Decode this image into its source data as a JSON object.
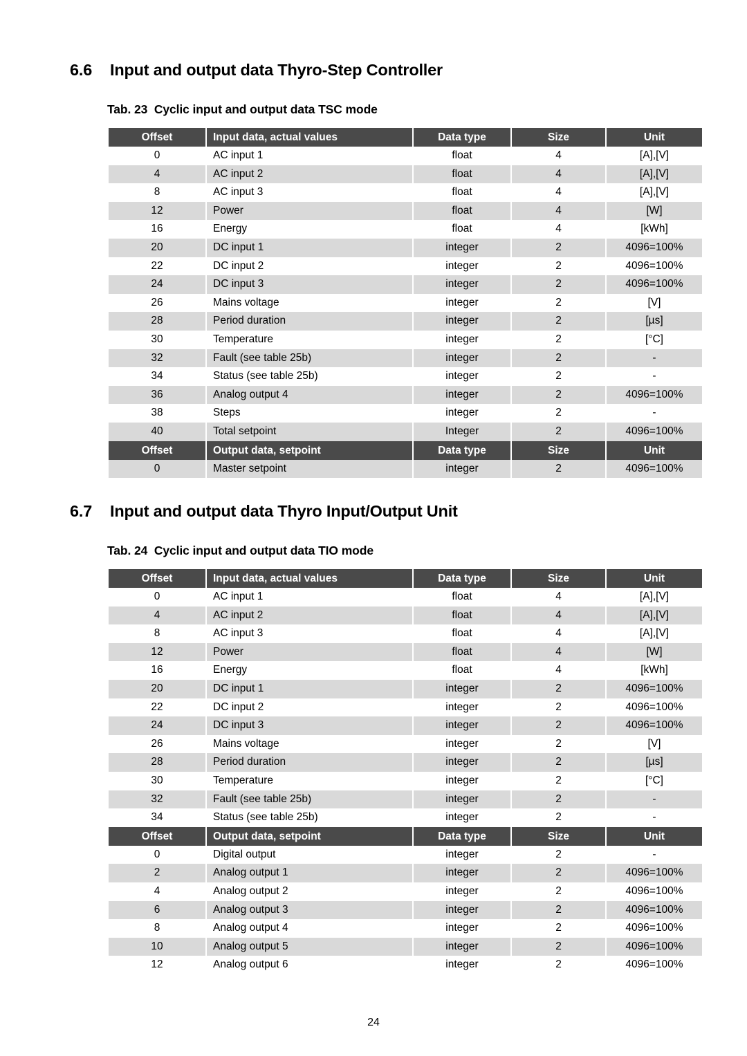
{
  "document": {
    "page_number": "24"
  },
  "sections": [
    {
      "number": "6.6",
      "title": "Input and output data Thyro-Step Controller",
      "caption": "Tab. 23  Cyclic input and output data TSC mode"
    },
    {
      "number": "6.7",
      "title": "Input and output data Thyro Input/Output Unit",
      "caption": "Tab. 24  Cyclic input and output data TIO mode"
    }
  ],
  "colors": {
    "header_bg": "#4a4a4a",
    "header_text": "#ffffff",
    "row_shade": "#d9d9d9",
    "row_plain": "#ffffff",
    "page_bg": "#ffffff"
  },
  "table_23": {
    "input_header": [
      "Offset",
      "Input data, actual values",
      "Data type",
      "Size",
      "Unit"
    ],
    "input_rows": [
      [
        "0",
        "AC input 1",
        "float",
        "4",
        "[A],[V]"
      ],
      [
        "4",
        "AC input 2",
        "float",
        "4",
        "[A],[V]"
      ],
      [
        "8",
        "AC input 3",
        "float",
        "4",
        "[A],[V]"
      ],
      [
        "12",
        "Power",
        "float",
        "4",
        "[W]"
      ],
      [
        "16",
        "Energy",
        "float",
        "4",
        "[kWh]"
      ],
      [
        "20",
        "DC input 1",
        "integer",
        "2",
        "4096=100%"
      ],
      [
        "22",
        "DC input 2",
        "integer",
        "2",
        "4096=100%"
      ],
      [
        "24",
        "DC input 3",
        "integer",
        "2",
        "4096=100%"
      ],
      [
        "26",
        "Mains voltage",
        "integer",
        "2",
        "[V]"
      ],
      [
        "28",
        "Period duration",
        "integer",
        "2",
        "[µs]"
      ],
      [
        "30",
        "Temperature",
        "integer",
        "2",
        "[°C]"
      ],
      [
        "32",
        "Fault (see table 25b)",
        "integer",
        "2",
        "-"
      ],
      [
        "34",
        "Status (see table 25b)",
        "integer",
        "2",
        "-"
      ],
      [
        "36",
        "Analog output 4",
        "integer",
        "2",
        "4096=100%"
      ],
      [
        "38",
        "Steps",
        "integer",
        "2",
        "-"
      ],
      [
        "40",
        "Total setpoint",
        "Integer",
        "2",
        "4096=100%"
      ]
    ],
    "output_header": [
      "Offset",
      "Output data, setpoint",
      "Data type",
      "Size",
      "Unit"
    ],
    "output_rows": [
      [
        "0",
        "Master setpoint",
        "integer",
        "2",
        "4096=100%"
      ]
    ]
  },
  "table_24": {
    "input_header": [
      "Offset",
      "Input data, actual values",
      "Data type",
      "Size",
      "Unit"
    ],
    "input_rows": [
      [
        "0",
        "AC input 1",
        "float",
        "4",
        "[A],[V]"
      ],
      [
        "4",
        "AC input 2",
        "float",
        "4",
        "[A],[V]"
      ],
      [
        "8",
        "AC input 3",
        "float",
        "4",
        "[A],[V]"
      ],
      [
        "12",
        "Power",
        "float",
        "4",
        "[W]"
      ],
      [
        "16",
        "Energy",
        "float",
        "4",
        "[kWh]"
      ],
      [
        "20",
        "DC input 1",
        "integer",
        "2",
        "4096=100%"
      ],
      [
        "22",
        "DC input 2",
        "integer",
        "2",
        "4096=100%"
      ],
      [
        "24",
        "DC input 3",
        "integer",
        "2",
        "4096=100%"
      ],
      [
        "26",
        "Mains voltage",
        "integer",
        "2",
        "[V]"
      ],
      [
        "28",
        "Period duration",
        "integer",
        "2",
        "[µs]"
      ],
      [
        "30",
        "Temperature",
        "integer",
        "2",
        "[°C]"
      ],
      [
        "32",
        "Fault (see table 25b)",
        "integer",
        "2",
        "-"
      ],
      [
        "34",
        "Status (see table 25b)",
        "integer",
        "2",
        "-"
      ]
    ],
    "output_header": [
      "Offset",
      "Output data, setpoint",
      "Data type",
      "Size",
      "Unit"
    ],
    "output_rows": [
      [
        "0",
        "Digital output",
        "integer",
        "2",
        "-"
      ],
      [
        "2",
        "Analog output 1",
        "integer",
        "2",
        "4096=100%"
      ],
      [
        "4",
        "Analog output 2",
        "integer",
        "2",
        "4096=100%"
      ],
      [
        "6",
        "Analog output 3",
        "integer",
        "2",
        "4096=100%"
      ],
      [
        "8",
        "Analog output 4",
        "integer",
        "2",
        "4096=100%"
      ],
      [
        "10",
        "Analog output 5",
        "integer",
        "2",
        "4096=100%"
      ],
      [
        "12",
        "Analog output 6",
        "integer",
        "2",
        "4096=100%"
      ]
    ]
  }
}
